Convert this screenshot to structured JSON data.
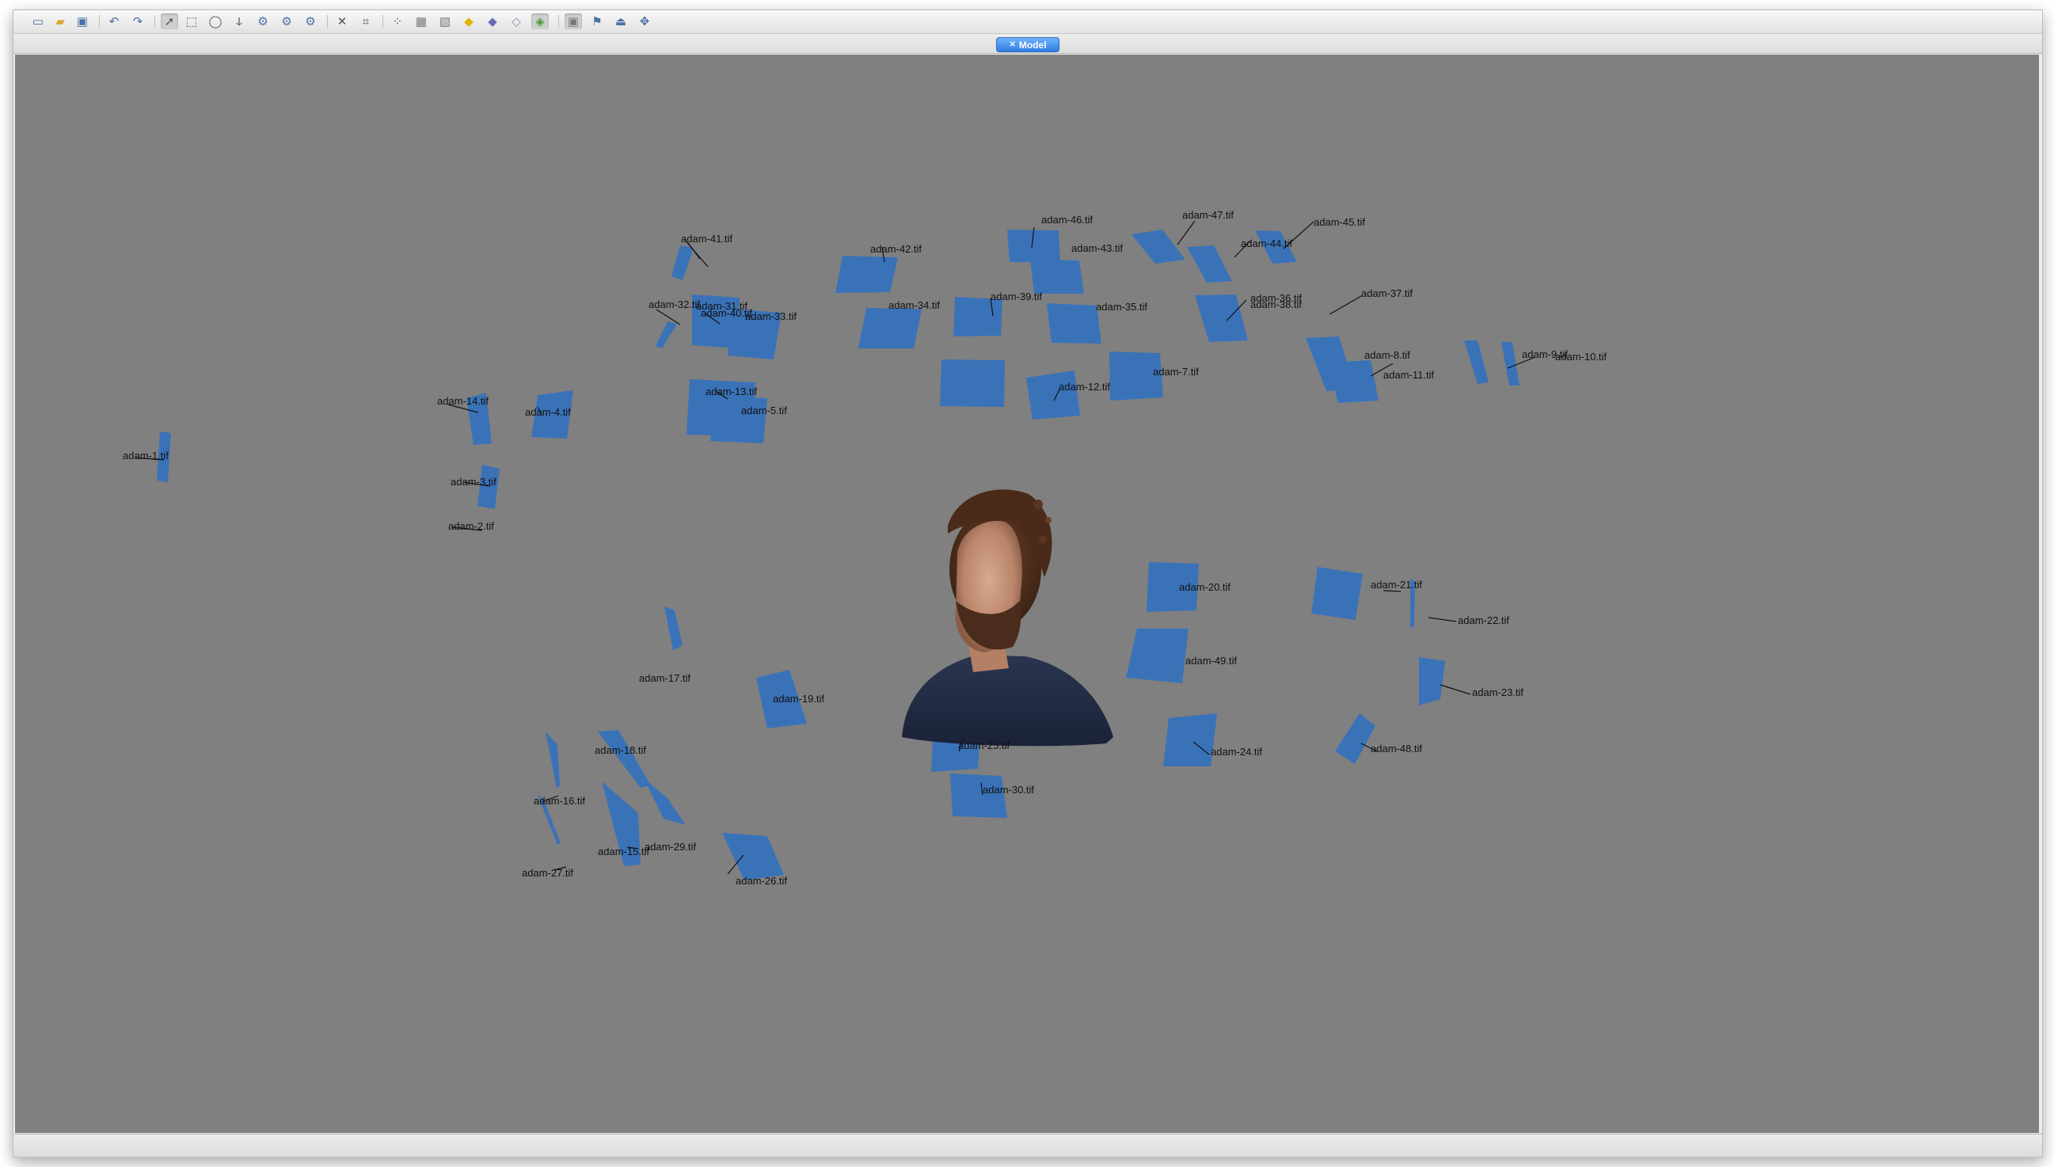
{
  "app": {
    "tab_label": "Model",
    "toolbar_icons": [
      "new-document-icon",
      "open-folder-icon",
      "save-icon",
      "undo-icon",
      "redo-icon",
      "select-pointer-icon",
      "rectangle-select-icon",
      "ellipse-select-icon",
      "free-select-icon",
      "select-all-icon",
      "invert-selection-icon",
      "deselect-icon",
      "delete-icon",
      "crop-icon",
      "dense-cloud-icon",
      "mesh-icon",
      "texture-icon",
      "shaded-icon",
      "solid-icon",
      "wireframe-icon",
      "textured-view-icon",
      "show-cameras-icon",
      "show-markers-icon",
      "show-region-icon",
      "navigation-icon"
    ]
  },
  "model": {
    "subject": "3D textured model of a bearded man wearing a dark blue t-shirt"
  },
  "cameras": [
    {
      "label": "adam-1.tif"
    },
    {
      "label": "adam-2.tif"
    },
    {
      "label": "adam-3.tif"
    },
    {
      "label": "adam-4.tif"
    },
    {
      "label": "adam-5.tif"
    },
    {
      "label": "adam-7.tif"
    },
    {
      "label": "adam-8.tif"
    },
    {
      "label": "adam-9.tif"
    },
    {
      "label": "adam-10.tif"
    },
    {
      "label": "adam-11.tif"
    },
    {
      "label": "adam-12.tif"
    },
    {
      "label": "adam-13.tif"
    },
    {
      "label": "adam-14.tif"
    },
    {
      "label": "adam-15.tif"
    },
    {
      "label": "adam-16.tif"
    },
    {
      "label": "adam-17.tif"
    },
    {
      "label": "adam-18.tif"
    },
    {
      "label": "adam-19.tif"
    },
    {
      "label": "adam-20.tif"
    },
    {
      "label": "adam-21.tif"
    },
    {
      "label": "adam-22.tif"
    },
    {
      "label": "adam-23.tif"
    },
    {
      "label": "adam-24.tif"
    },
    {
      "label": "adam-25.tif"
    },
    {
      "label": "adam-26.tif"
    },
    {
      "label": "adam-27.tif"
    },
    {
      "label": "adam-29.tif"
    },
    {
      "label": "adam-30.tif"
    },
    {
      "label": "adam-31.tif"
    },
    {
      "label": "adam-32.tif"
    },
    {
      "label": "adam-33.tif"
    },
    {
      "label": "adam-34.tif"
    },
    {
      "label": "adam-35.tif"
    },
    {
      "label": "adam-36.tif"
    },
    {
      "label": "adam-37.tif"
    },
    {
      "label": "adam-38.tif"
    },
    {
      "label": "adam-39.tif"
    },
    {
      "label": "adam-40.tif"
    },
    {
      "label": "adam-41.tif"
    },
    {
      "label": "adam-42.tif"
    },
    {
      "label": "adam-43.tif"
    },
    {
      "label": "adam-44.tif"
    },
    {
      "label": "adam-45.tif"
    },
    {
      "label": "adam-46.tif"
    },
    {
      "label": "adam-47.tif"
    },
    {
      "label": "adam-48.tif"
    },
    {
      "label": "adam-49.tif"
    }
  ],
  "colors": {
    "viewport_bg": "#808080",
    "camera_plane": "#3a72b8",
    "tab_active": "#2f7de1"
  }
}
